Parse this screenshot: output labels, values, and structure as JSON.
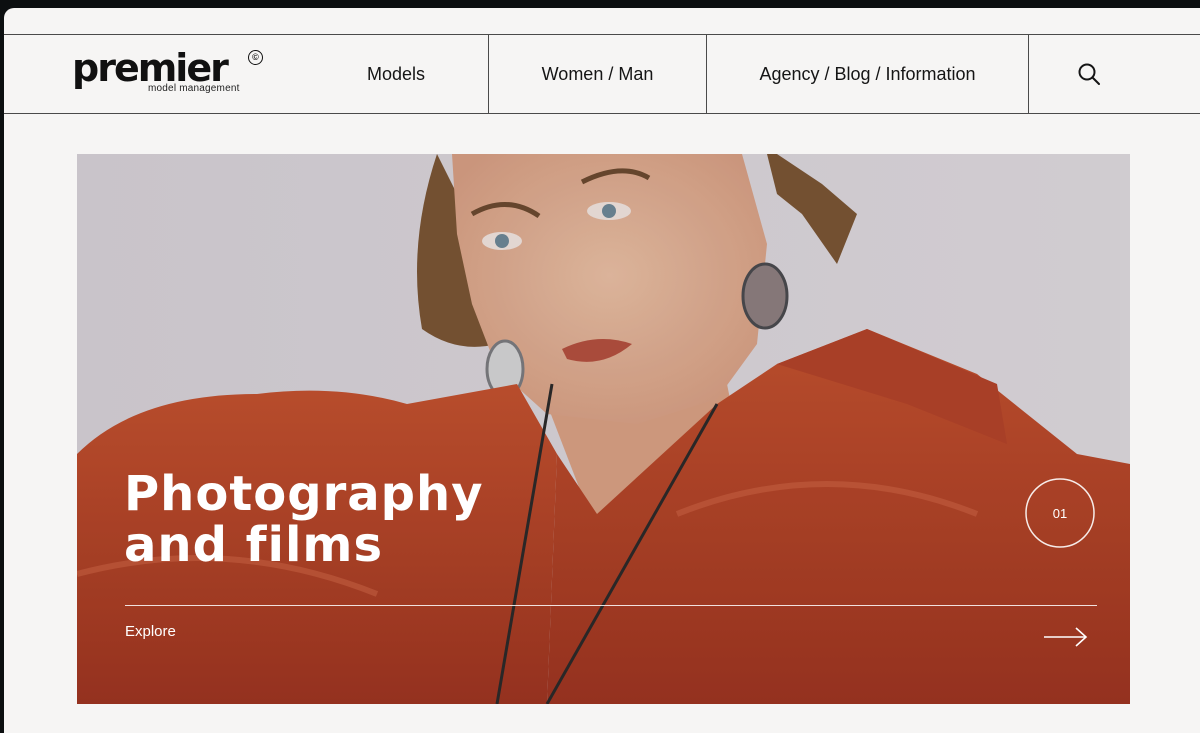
{
  "brand": {
    "name": "premier",
    "mark": "©",
    "tagline": "model management"
  },
  "nav": {
    "items": [
      {
        "label": "Models"
      },
      {
        "label": "Women / Man"
      },
      {
        "label": "Agency / Blog / Information"
      }
    ],
    "search_icon": "search-icon"
  },
  "hero": {
    "title": "Photography\nand films",
    "cta_label": "Explore",
    "slide_counter": "01",
    "arrow_icon": "arrow-right-icon",
    "colors": {
      "jacket": "#b8442a",
      "background": "#d9d5da",
      "text": "#ffffff"
    }
  }
}
